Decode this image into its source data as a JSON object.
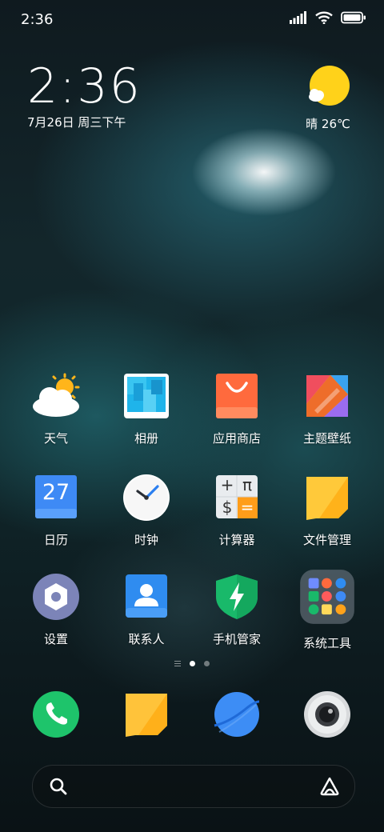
{
  "status_bar": {
    "time": "2:36"
  },
  "clock": {
    "time": "2:36",
    "date": "7月26日 周三下午"
  },
  "weather": {
    "text": "晴 26℃"
  },
  "apps": [
    {
      "label": "天气",
      "icon": "weather-icon"
    },
    {
      "label": "相册",
      "icon": "gallery-icon"
    },
    {
      "label": "应用商店",
      "icon": "app-store-icon"
    },
    {
      "label": "主题壁纸",
      "icon": "themes-icon"
    },
    {
      "label": "日历",
      "icon": "calendar-icon",
      "badge": "27"
    },
    {
      "label": "时钟",
      "icon": "clock-icon"
    },
    {
      "label": "计算器",
      "icon": "calculator-icon"
    },
    {
      "label": "文件管理",
      "icon": "file-manager-icon"
    },
    {
      "label": "设置",
      "icon": "settings-icon"
    },
    {
      "label": "联系人",
      "icon": "contacts-icon"
    },
    {
      "label": "手机管家",
      "icon": "security-icon"
    },
    {
      "label": "系统工具",
      "icon": "system-tools-folder-icon"
    }
  ],
  "calculator_symbols": [
    "+",
    "π",
    "$",
    "="
  ],
  "dock": [
    {
      "icon": "phone-icon"
    },
    {
      "icon": "messages-icon"
    },
    {
      "icon": "browser-icon"
    },
    {
      "icon": "camera-icon"
    }
  ],
  "search_bar": {
    "left_icon": "search-icon",
    "right_icon": "assistant-icon"
  },
  "colors": {
    "phone": "#1ec46b",
    "messages": "#ffc33a",
    "browser": "#3d8df5",
    "app_store": "#ff6a3d",
    "calendar": "#3e8af5",
    "contacts": "#2f8cf0",
    "security": "#19b96a",
    "settings": "#7c84b8"
  }
}
